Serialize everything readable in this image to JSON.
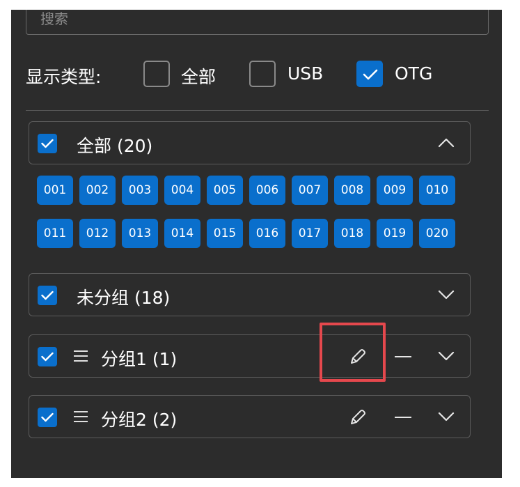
{
  "search": {
    "placeholder": "搜索"
  },
  "filter": {
    "label": "显示类型:",
    "options": [
      {
        "label": "全部",
        "checked": false
      },
      {
        "label": "USB",
        "checked": false
      },
      {
        "label": "OTG",
        "checked": true
      }
    ]
  },
  "groups": [
    {
      "title": "全部 (20)",
      "checked": true,
      "expanded": true,
      "editable": false
    },
    {
      "title": "未分组 (18)",
      "checked": true,
      "expanded": false,
      "editable": false
    },
    {
      "title": "分组1 (1)",
      "checked": true,
      "expanded": false,
      "editable": true
    },
    {
      "title": "分组2 (2)",
      "checked": true,
      "expanded": false,
      "editable": true
    }
  ],
  "devices": [
    "001",
    "002",
    "003",
    "004",
    "005",
    "006",
    "007",
    "008",
    "009",
    "010",
    "011",
    "012",
    "013",
    "014",
    "015",
    "016",
    "017",
    "018",
    "019",
    "020"
  ],
  "colors": {
    "accent": "#0a6fcc",
    "panel": "#2c2c2c",
    "highlight": "#e5484d"
  }
}
